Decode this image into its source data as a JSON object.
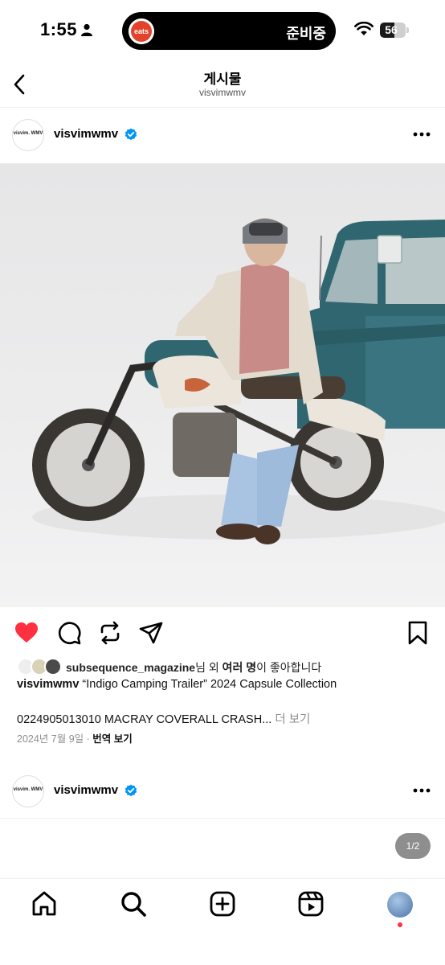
{
  "status_bar": {
    "time": "1:55",
    "island_app_label": "eats",
    "island_status": "준비중",
    "battery_level": "56",
    "battery_fraction": 0.56
  },
  "header": {
    "title": "게시물",
    "subtitle": "visvimwmv"
  },
  "post": {
    "logo_text": "visvim. WMV",
    "username": "visvimwmv",
    "liked_by_user": "subsequence_magazine",
    "liked_by_suffix_1": "님 외 ",
    "liked_by_many": "여러 명",
    "liked_by_suffix_2": "이 좋아합니다",
    "caption_user": "visvimwmv",
    "caption_text": " “Indigo Camping Trailer” 2024 Capsule Collection",
    "caption_line2": "0224905013010 MACRAY COVERALL CRASH...",
    "more_label": " 더 보기",
    "date": "2024년 7월 9일",
    "separator": " · ",
    "translate_label": "번역 보기",
    "colors": {
      "like": "#ff3040",
      "verified": "#0095f6"
    }
  },
  "next_post": {
    "logo_text": "visvim. WMV",
    "username": "visvimwmv",
    "page_indicator": "1/2"
  },
  "icons": [
    "back-icon",
    "verified-icon",
    "more-icon",
    "heart-icon",
    "comment-icon",
    "repost-icon",
    "share-icon",
    "bookmark-icon",
    "home-icon",
    "search-icon",
    "create-icon",
    "reels-icon"
  ]
}
